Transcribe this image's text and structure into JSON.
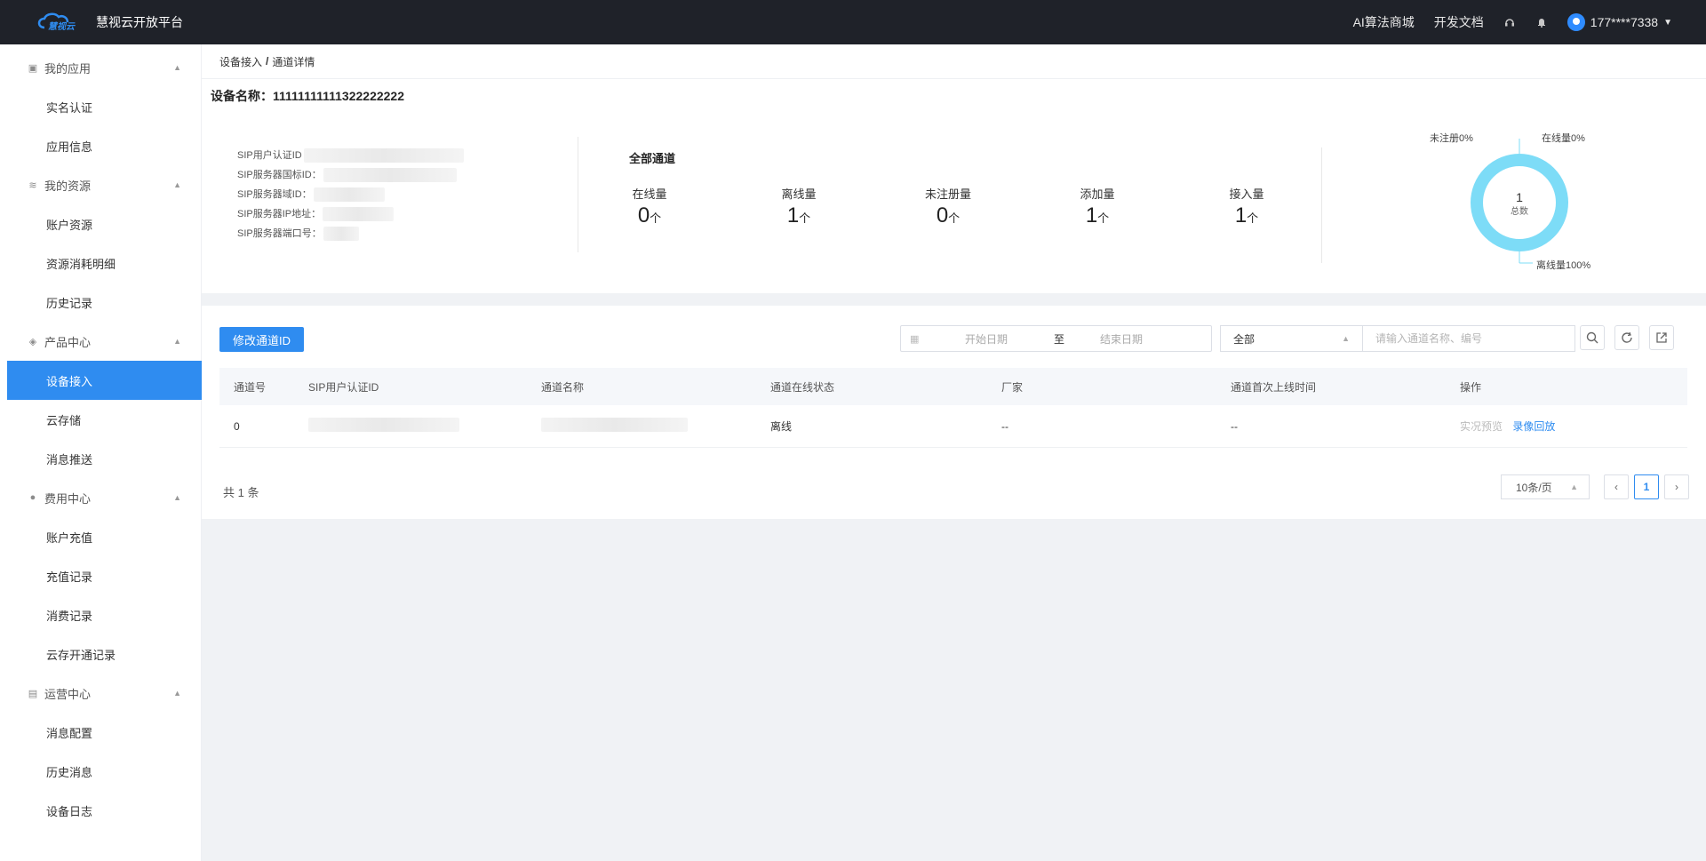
{
  "header": {
    "logo_text": "慧视云",
    "app_title": "慧视云开放平台",
    "links": [
      "AI算法商城",
      "开发文档"
    ],
    "user": "177****7338"
  },
  "sidebar": {
    "groups": [
      {
        "label": "我的应用",
        "items": [
          "实名认证",
          "应用信息"
        ]
      },
      {
        "label": "我的资源",
        "items": [
          "账户资源",
          "资源消耗明细",
          "历史记录"
        ]
      },
      {
        "label": "产品中心",
        "items": [
          "设备接入",
          "云存储",
          "消息推送"
        ]
      },
      {
        "label": "费用中心",
        "items": [
          "账户充值",
          "充值记录",
          "消费记录",
          "云存开通记录"
        ]
      },
      {
        "label": "运营中心",
        "items": [
          "消息配置",
          "历史消息",
          "设备日志"
        ]
      }
    ],
    "active": "设备接入"
  },
  "breadcrumb": {
    "parent": "设备接入",
    "sep": "/",
    "current": "通道详情"
  },
  "device": {
    "label": "设备名称：",
    "name": "11111111111322222222"
  },
  "sip": {
    "labels": [
      "SIP用户认证ID",
      "SIP服务器国标ID：",
      "SIP服务器域ID：",
      "SIP服务器IP地址：",
      "SIP服务器端口号："
    ]
  },
  "channels": {
    "title": "全部通道",
    "unit": "个",
    "stats": [
      {
        "label": "在线量",
        "value": "0"
      },
      {
        "label": "离线量",
        "value": "1"
      },
      {
        "label": "未注册量",
        "value": "0"
      },
      {
        "label": "添加量",
        "value": "1"
      },
      {
        "label": "接入量",
        "value": "1"
      }
    ]
  },
  "donut": {
    "center_value": "1",
    "center_label": "总数",
    "legend_unregistered": "未注册0%",
    "legend_online": "在线量0%",
    "legend_offline": "离线量100%",
    "offline_fraction": 1.0,
    "color": "#7ddcf7"
  },
  "toolbar": {
    "edit_button": "修改通道ID",
    "start_placeholder": "开始日期",
    "to": "至",
    "end_placeholder": "结束日期",
    "status_select": "全部",
    "search_placeholder": "请输入通道名称、编号"
  },
  "table": {
    "headers": [
      "通道号",
      "SIP用户认证ID",
      "通道名称",
      "通道在线状态",
      "厂家",
      "通道首次上线时间",
      "操作"
    ],
    "rows": [
      {
        "no": "0",
        "status": "离线",
        "vendor": "--",
        "first_online": "--",
        "op_preview": "实况预览",
        "op_playback": "录像回放"
      }
    ]
  },
  "pagination": {
    "total": "共 1 条",
    "page_size": "10条/页",
    "current": "1"
  },
  "colors": {
    "primary": "#2f8cf0",
    "header_bg": "#1f2229"
  }
}
